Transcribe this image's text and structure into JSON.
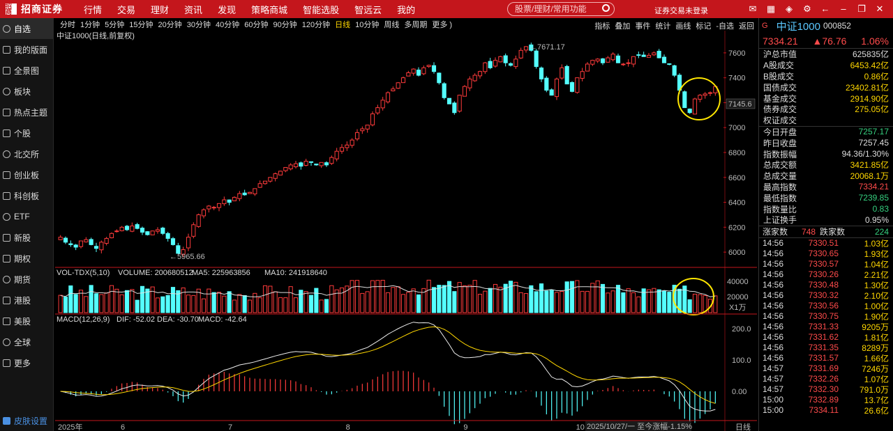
{
  "app": {
    "logo_mark": "招商",
    "logo_name": "招商证券",
    "menu": [
      "行情",
      "交易",
      "理财",
      "资讯",
      "发现",
      "策略商城",
      "智能选股",
      "智远云",
      "我的"
    ],
    "search_placeholder": "股票/理财/常用功能",
    "login_status": "证券交易未登录"
  },
  "sidebar": {
    "items": [
      {
        "label": "自选",
        "icon": "star-icon"
      },
      {
        "label": "我的版面",
        "icon": "layout-icon"
      },
      {
        "label": "全景图",
        "icon": "panorama-icon"
      },
      {
        "label": "板块",
        "icon": "sector-icon"
      },
      {
        "label": "热点主题",
        "icon": "fire-icon"
      },
      {
        "label": "个股",
        "icon": "stock-icon"
      },
      {
        "label": "北交所",
        "icon": "exchange-icon"
      },
      {
        "label": "创业板",
        "icon": "growth-board-icon"
      },
      {
        "label": "科创板",
        "icon": "star-market-icon"
      },
      {
        "label": "ETF",
        "icon": "etf-icon"
      },
      {
        "label": "新股",
        "icon": "ipo-icon"
      },
      {
        "label": "期权",
        "icon": "options-icon"
      },
      {
        "label": "期货",
        "icon": "futures-icon"
      },
      {
        "label": "港股",
        "icon": "hk-stock-icon"
      },
      {
        "label": "美股",
        "icon": "us-stock-icon"
      },
      {
        "label": "全球",
        "icon": "globe-icon"
      },
      {
        "label": "更多",
        "icon": "more-icon"
      }
    ],
    "skin_label": "皮肤设置"
  },
  "periods": [
    "分时",
    "1分钟",
    "5分钟",
    "15分钟",
    "20分钟",
    "30分钟",
    "40分钟",
    "60分钟",
    "90分钟",
    "120分钟",
    "日线",
    "10分钟",
    "周线",
    "多周期",
    "更多 )"
  ],
  "active_period": "日线",
  "tools": [
    "指标",
    "叠加",
    "事件",
    "统计",
    "画线",
    "标记",
    "-自选",
    "返回"
  ],
  "chart": {
    "title": "中证1000(日线,前复权)",
    "price_axis": [
      "7600",
      "7400",
      "7200",
      "7000",
      "6800",
      "6600",
      "6400",
      "6200",
      "6000"
    ],
    "high_label": "7671.17",
    "low_label": "5965.66",
    "current_price_tag": "7145.6",
    "vol_header": {
      "name": "VOL-TDX(5,10)",
      "volume": "VOLUME: 200680512",
      "ma5": "MA5: 225963856",
      "ma10": "MA10: 241918640"
    },
    "vol_axis": [
      "40000",
      "20000"
    ],
    "vol_unit": "X1万",
    "macd_header": {
      "name": "MACD(12,26,9)",
      "dif": "DIF: -52.02",
      "dea": "DEA: -30.70",
      "macd": "MACD: -42.64"
    },
    "macd_axis": [
      "200.0",
      "100.0",
      "0.00"
    ],
    "x_labels": [
      "2025年",
      "6",
      "7",
      "8",
      "9",
      "10"
    ],
    "date_tag": "2025/10/27/一  至今涨幅-1.15%",
    "period_label": "日线"
  },
  "chart_data": {
    "type": "candlestick",
    "ylim": [
      5900,
      7700
    ],
    "close_series": [
      6120,
      6080,
      6060,
      6040,
      6090,
      6100,
      6060,
      6030,
      6080,
      6110,
      6150,
      6170,
      6200,
      6180,
      6210,
      6190,
      6160,
      6140,
      6170,
      6180,
      6150,
      6110,
      6060,
      5990,
      6020,
      6120,
      6220,
      6300,
      6340,
      6370,
      6360,
      6390,
      6420,
      6400,
      6440,
      6470,
      6460,
      6480,
      6510,
      6550,
      6570,
      6600,
      6630,
      6650,
      6680,
      6700,
      6710,
      6690,
      6730,
      6720,
      6700,
      6720,
      6700,
      6760,
      6810,
      6840,
      6860,
      6900,
      6960,
      6990,
      7020,
      7110,
      7160,
      7220,
      7280,
      7310,
      7360,
      7400,
      7440,
      7470,
      7420,
      7480,
      7500,
      7450,
      7360,
      7240,
      7190,
      7120,
      7260,
      7330,
      7390,
      7420,
      7450,
      7520,
      7480,
      7540,
      7570,
      7520,
      7500,
      7550,
      7620,
      7650,
      7620,
      7490,
      7390,
      7300,
      7260,
      7390,
      7480,
      7350,
      7290,
      7400,
      7450,
      7510,
      7540,
      7550,
      7520,
      7560,
      7590,
      7520,
      7510,
      7520,
      7570,
      7580,
      7570,
      7580,
      7600,
      7560,
      7520,
      7510,
      7420,
      7300,
      7160,
      7120,
      7230,
      7260,
      7270,
      7280,
      7330
    ],
    "annotations": {
      "high": 7671.17,
      "low": 5965.66,
      "last_price_line": 7145.6
    }
  },
  "quote": {
    "flag": "G",
    "name": "中证1000",
    "code": "000852",
    "price": "7334.21",
    "change": "▲76.76",
    "pct": "1.06%",
    "market_cap_label": "沪总市值",
    "market_cap": "625835亿",
    "turnover_rows": [
      {
        "label": "A股成交",
        "value": "6453.42亿"
      },
      {
        "label": "B股成交",
        "value": "0.86亿"
      },
      {
        "label": "国债成交",
        "value": "23402.81亿"
      },
      {
        "label": "基金成交",
        "value": "2914.90亿"
      },
      {
        "label": "债券成交",
        "value": "275.05亿"
      },
      {
        "label": "权证成交",
        "value": ""
      }
    ],
    "stat_rows": [
      {
        "label": "今日开盘",
        "value": "7257.17",
        "tone": "grn"
      },
      {
        "label": "昨日收盘",
        "value": "7257.45",
        "tone": "wht"
      },
      {
        "label": "指数振幅",
        "value": "94.36/1.30%",
        "tone": "wht"
      },
      {
        "label": "总成交额",
        "value": "3421.85亿",
        "tone": "yel"
      },
      {
        "label": "总成交量",
        "value": "20068.1万",
        "tone": "yel"
      },
      {
        "label": "最高指数",
        "value": "7334.21",
        "tone": "red"
      },
      {
        "label": "最低指数",
        "value": "7239.85",
        "tone": "grn"
      },
      {
        "label": "指数量比",
        "value": "0.83",
        "tone": "grn"
      },
      {
        "label": "上证换手",
        "value": "0.95%",
        "tone": "wht"
      }
    ],
    "up_label": "涨家数",
    "up_count": "748",
    "down_label": "跌家数",
    "down_count": "224",
    "ticks": [
      {
        "t": "14:56",
        "p": "7330.51",
        "q": "1.03亿"
      },
      {
        "t": "14:56",
        "p": "7330.65",
        "q": "1.93亿"
      },
      {
        "t": "14:56",
        "p": "7330.57",
        "q": "1.04亿"
      },
      {
        "t": "14:56",
        "p": "7330.26",
        "q": "2.21亿"
      },
      {
        "t": "14:56",
        "p": "7330.48",
        "q": "1.30亿"
      },
      {
        "t": "14:56",
        "p": "7330.32",
        "q": "2.10亿"
      },
      {
        "t": "14:56",
        "p": "7330.56",
        "q": "1.00亿"
      },
      {
        "t": "14:56",
        "p": "7330.75",
        "q": "1.90亿"
      },
      {
        "t": "14:56",
        "p": "7331.33",
        "q": "9205万"
      },
      {
        "t": "14:56",
        "p": "7331.62",
        "q": "1.81亿"
      },
      {
        "t": "14:56",
        "p": "7331.35",
        "q": "8289万"
      },
      {
        "t": "14:56",
        "p": "7331.57",
        "q": "1.66亿"
      },
      {
        "t": "14:57",
        "p": "7331.69",
        "q": "7246万"
      },
      {
        "t": "14:57",
        "p": "7332.26",
        "q": "1.07亿"
      },
      {
        "t": "14:57",
        "p": "7332.30",
        "q": "791.0万"
      },
      {
        "t": "15:00",
        "p": "7332.89",
        "q": "13.7亿"
      },
      {
        "t": "15:00",
        "p": "7334.11",
        "q": "26.6亿"
      }
    ]
  }
}
